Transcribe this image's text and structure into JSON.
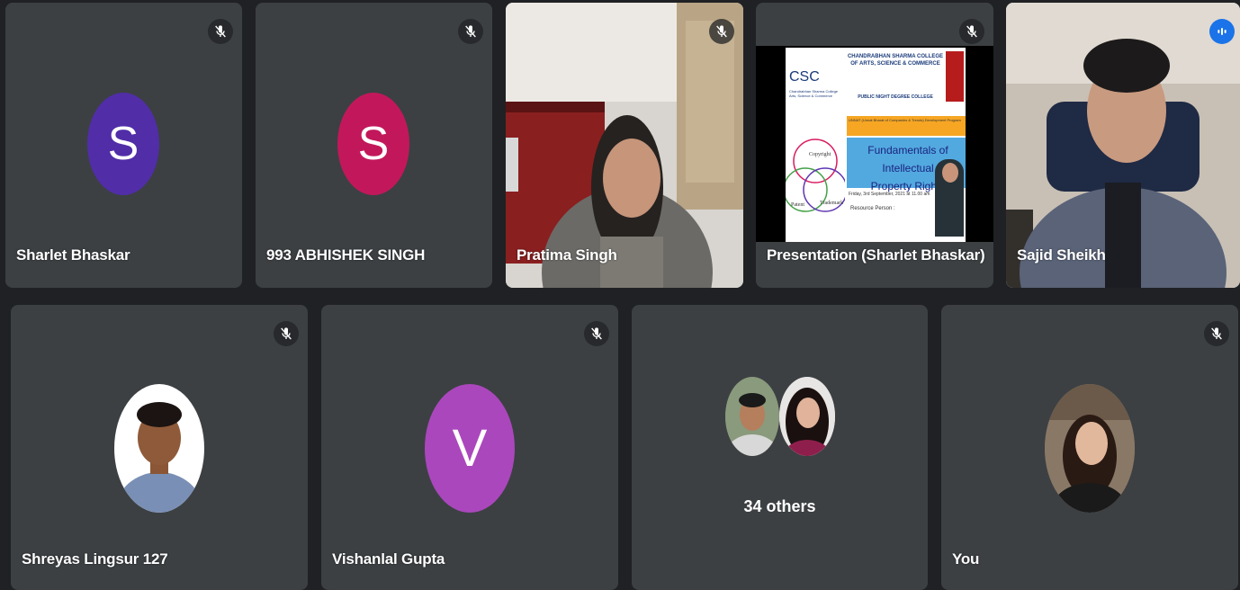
{
  "participants_row1": [
    {
      "name": "Sharlet Bhaskar",
      "initial": "S",
      "color": "#512da8"
    },
    {
      "name": "993 ABHISHEK SINGH",
      "initial": "S",
      "color": "#c2185b"
    },
    {
      "name": "Pratima Singh"
    },
    {
      "name": "Presentation (Sharlet Bhaskar)"
    },
    {
      "name": "Sajid Sheikh"
    }
  ],
  "participants_row2": [
    {
      "name": "Shreyas Lingsur 127"
    },
    {
      "name": "Vishanlal Gupta",
      "initial": "V",
      "color": "#ab47bc"
    },
    {
      "others_label": "34 others"
    },
    {
      "name": "You"
    }
  ],
  "slide": {
    "logo": "CSC",
    "logo_sub": "Chandrabhan Sharma College Arts, Science & Commerce",
    "college": "CHANDRABHAN SHARMA COLLEGE OF ARTS, SCIENCE & COMMERCE",
    "college2": "PUBLIC NIGHT DEGREE COLLEGE",
    "band": "UNNAT (Unnat Bharat of Companies & Trends) Development Program",
    "heading_line1": "Fundamentals of Intellectual",
    "heading_line2": "Property Rights",
    "date": "Friday, 3rd September, 2021 at 11.00 am",
    "rp_label": "Resource Person :",
    "venn": [
      "Copyright",
      "Patent",
      "Trademark"
    ]
  },
  "colors": {
    "background": "#202124",
    "tile": "#3c4043",
    "speaking_outline": "#8ab4f8",
    "speaking_badge": "#1a73e8"
  }
}
